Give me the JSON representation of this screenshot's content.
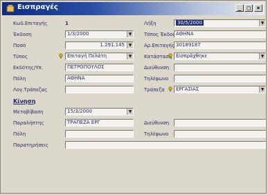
{
  "window": {
    "title": "Εισπραγές",
    "controls": {
      "minimize": "_",
      "maximize": "□",
      "close": "×"
    }
  },
  "form": {
    "kod_label": "Κωδ.Επιταγής",
    "kod_value": "1",
    "lixi_label": "Λήξη",
    "lixi_value": "30/5/2000",
    "ekdosi_label": "Έκδοση",
    "ekdosi_value": "1/3/2000",
    "topos_label": "Τόπος Έκδοσης",
    "topos_value": "ΑΘΗΝΑ",
    "poso_label": "Ποσό",
    "poso_value": "1.291.145",
    "arith_label": "Αρ.Επιταγής",
    "arith_value": "30189187",
    "typos_label": "Τύπος",
    "typos_value": "Επιταγή Πελάτη",
    "katastasi_label": "Κατάσταση",
    "katastasi_value": "Εισπράχθηκε",
    "ekdotis_label": "Εκδότης/Υπ.",
    "ekdotis_value": "ΠΕΤΡΟΠΟΥΛΟΣ",
    "dieuthynsi_label": "Διεύθυνση",
    "dieuthynsi_value": "",
    "poli_label": "Πόλη",
    "poli_value": "ΑΘΗΝΑ",
    "tilefono_label": "Τηλέφωνο",
    "tilefono_value": "",
    "logtrap_label": "Λογ.Τράπεζας",
    "logtrap_value": "",
    "trapeza_label": "Τράπεζα",
    "trapeza_value": "ΕΡΓΑΣΙΑΣ"
  },
  "kinisi": {
    "section_title": "Κίνηση",
    "metavivasi_label": "Μεταβίβαση",
    "metavivasi_value": "15/3/2000",
    "paralipti_label": "Παραλήπτης",
    "paralipti_value": "ΤΡΑΠΕΖΑ ΕΡΓ",
    "dieuthynsi_label": "Διεύθυνση",
    "dieuthynsi_value": "",
    "poli_label": "Πόλη",
    "poli_value": "",
    "tilefono_label": "Τηλέφωνο",
    "tilefono_value": "",
    "paratiriseis_label": "Παρατηρήσεις",
    "paratiriseis_value": ""
  },
  "colors": {
    "accent": "#0b2b86",
    "label": "#2a2a66",
    "bulb": "#d8b400"
  },
  "icons": {
    "window": "window-icon",
    "hint": "lightbulb-icon",
    "dropdown": "chevron-down-icon"
  }
}
